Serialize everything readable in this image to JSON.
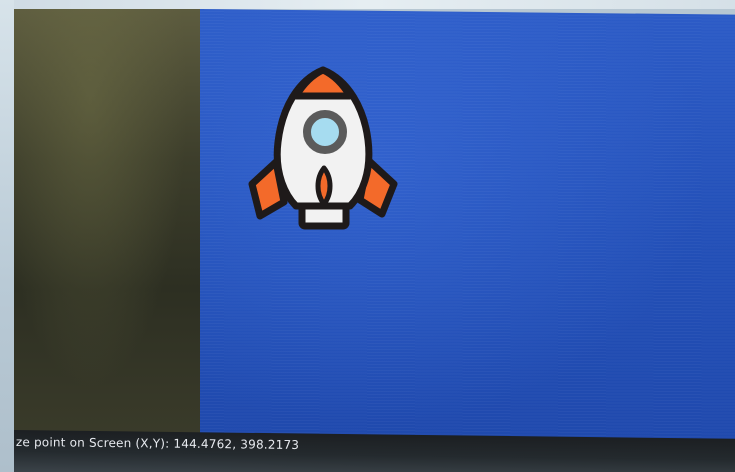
{
  "screen": {
    "gaze_label": "ze point on Screen (X,Y):",
    "gaze_x": "144.4762",
    "gaze_y": "398.2173",
    "gaze_text": "ze point on Screen (X,Y): 144.4762, 398.2173"
  },
  "display": {
    "background_color": "#2350b8",
    "sprite_icon": "rocket-icon"
  },
  "colors": {
    "side_panel": "#3d3e2b",
    "bottom_bar": "#242a2e",
    "rocket_fin": "#f36a2a",
    "rocket_body": "#f2f2f2",
    "rocket_window": "#a6dcf0",
    "outline": "#1e1a1a"
  }
}
